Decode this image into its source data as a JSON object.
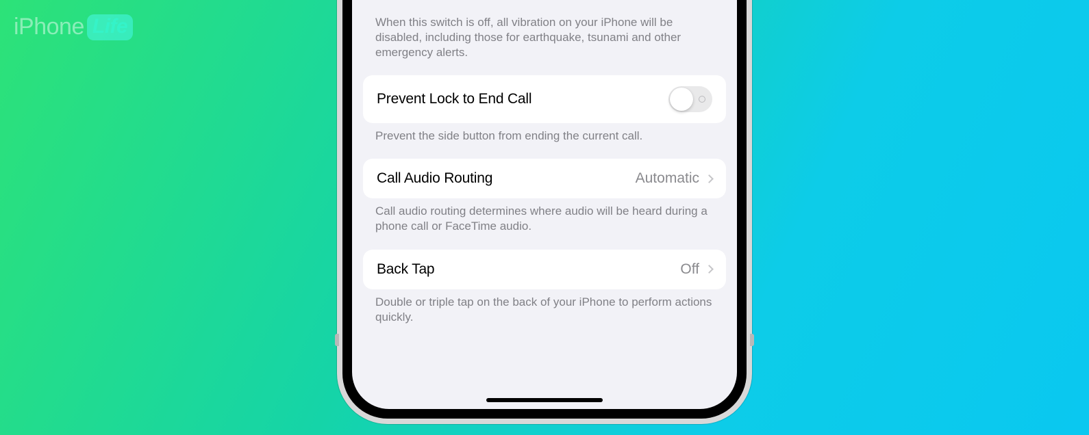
{
  "watermark": {
    "brand": "iPhone",
    "suffix": "Life"
  },
  "vibration_footer": "When this switch is off, all vibration on your iPhone will be disabled, including those for earthquake, tsunami and other emergency alerts.",
  "prevent_lock": {
    "label": "Prevent Lock to End Call",
    "state": "off",
    "footer": "Prevent the side button from ending the current call."
  },
  "call_audio": {
    "label": "Call Audio Routing",
    "value": "Automatic",
    "footer": "Call audio routing determines where audio will be heard during a phone call or FaceTime audio."
  },
  "back_tap": {
    "label": "Back Tap",
    "value": "Off",
    "footer": "Double or triple tap on the back of your iPhone to perform actions quickly."
  }
}
